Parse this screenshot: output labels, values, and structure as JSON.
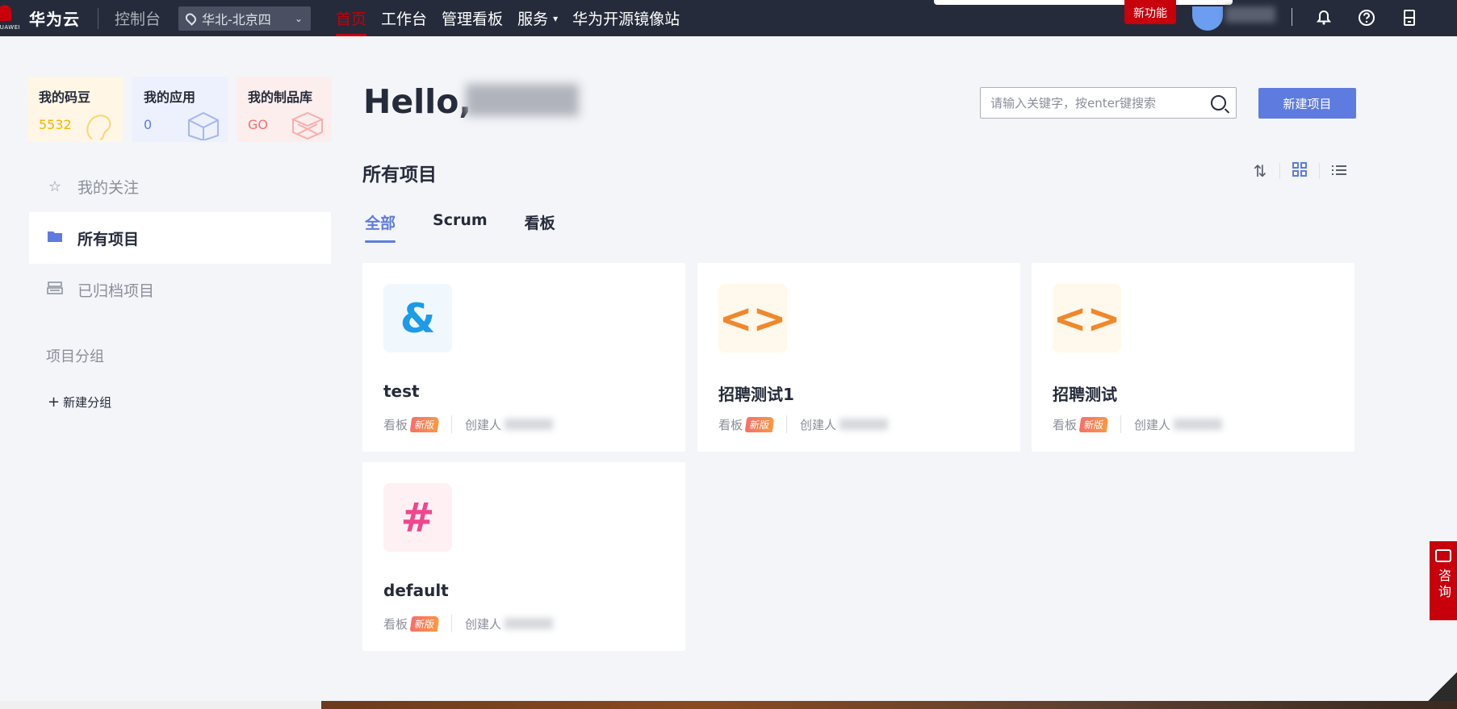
{
  "topnav": {
    "logo_sub": "HUAWEI",
    "brand": "华为云",
    "console": "控制台",
    "region": "华北-北京四",
    "links": [
      {
        "label": "首页",
        "active": true
      },
      {
        "label": "工作台"
      },
      {
        "label": "管理看板"
      },
      {
        "label": "服务",
        "dropdown": true
      },
      {
        "label": "华为开源镜像站"
      }
    ],
    "new_feature": "新功能",
    "icons": [
      "bell-icon",
      "help-icon",
      "phone-icon"
    ]
  },
  "sidebar": {
    "stats": [
      {
        "title": "我的码豆",
        "value": "5532"
      },
      {
        "title": "我的应用",
        "value": "0"
      },
      {
        "title": "我的制品库",
        "value": "GO"
      }
    ],
    "items": [
      {
        "icon": "☆",
        "label": "我的关注"
      },
      {
        "icon": "▬",
        "label": "所有项目",
        "active": true
      },
      {
        "icon": "☰",
        "label": "已归档项目"
      }
    ],
    "group_label": "项目分组",
    "new_group": "新建分组"
  },
  "main": {
    "hello": "Hello,",
    "search_placeholder": "请输入关键字，按enter键搜索",
    "new_project": "新建项目",
    "section_title": "所有项目",
    "tabs": [
      "全部",
      "Scrum",
      "看板"
    ],
    "projects": [
      {
        "name": "test",
        "icon": "&",
        "type": "看板",
        "badge": "新版",
        "creator": "创建人"
      },
      {
        "name": "招聘测试1",
        "icon": "<>",
        "type": "看板",
        "badge": "新版",
        "creator": "创建人"
      },
      {
        "name": "招聘测试",
        "icon": "<>",
        "type": "看板",
        "badge": "新版",
        "creator": "创建人"
      },
      {
        "name": "default",
        "icon": "#",
        "type": "看板",
        "badge": "新版",
        "creator": "创建人"
      }
    ]
  },
  "consult": {
    "label": "咨询"
  },
  "colors": {
    "nav_bg": "#252b3a",
    "accent": "#5e7ce0",
    "brand_red": "#c7000b"
  }
}
